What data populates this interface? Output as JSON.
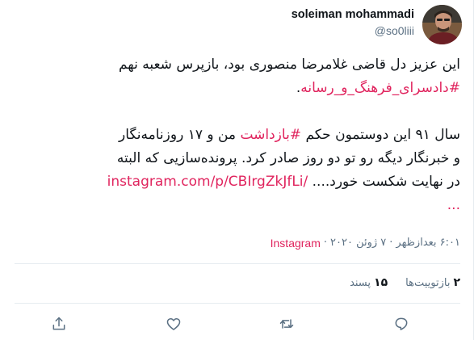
{
  "author": {
    "display_name": "soleiman mohammadi",
    "handle": "@so0liii"
  },
  "tweet": {
    "line1": "این عزیز دل قاضی غلامرضا منصوری بود، بازپرس شعبه نهم",
    "line2_hashtag": "#دادسرای_فرهنگ_و_رسانه",
    "line2_suffix": ".",
    "line3_prefix": "سال ۹۱ این دوستمون حکم",
    "line3_hashtag": "#بازداشت",
    "line3_suffix": "من و ۱۷ روزنامه‌نگار",
    "line4": "و خبرنگار دیگه رو تو دو روز صادر کرد. پرونده‌سازیی که البته",
    "line5_prefix": "در نهایت شکست خورد....",
    "line5_link": "instagram.com/p/CBIrgZkJfLi/",
    "line6_link": "..."
  },
  "meta": {
    "time": "۶:۰۱ بعدازظهر",
    "separator": "·",
    "date": "۷ ژوئن ۲۰۲۰",
    "source": "Instagram"
  },
  "stats": {
    "retweets_count": "۲",
    "retweets_label": "بازتوییت‌ها",
    "likes_count": "۱۵",
    "likes_label": "پسند"
  },
  "actions": {
    "icons": [
      "share-icon",
      "like-icon",
      "retweet-icon",
      "reply-icon"
    ]
  },
  "colors": {
    "accent": "#e0245e",
    "text": "#0f1419",
    "secondary": "#5b7083",
    "divider": "#e6ecf0"
  }
}
